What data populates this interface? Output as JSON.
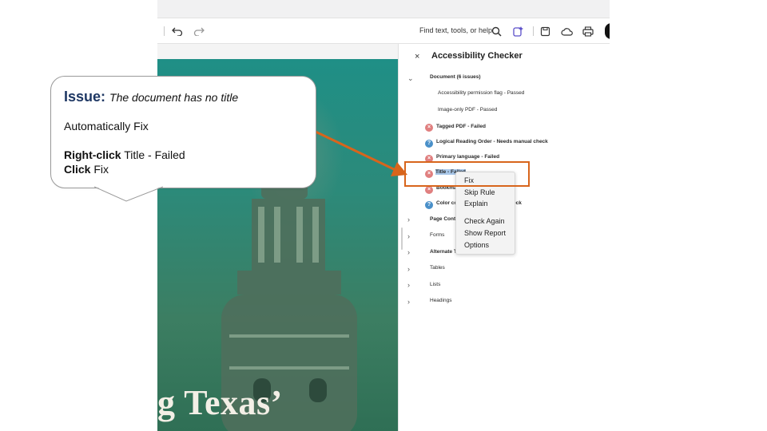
{
  "toolbar": {
    "find_text": "Find text, tools, or help",
    "accent_color": "#1f6feb"
  },
  "document": {
    "heading_fragment": "g Texas’"
  },
  "panel": {
    "close_label": "×",
    "title": "Accessibility Checker",
    "document_group": "Document (6 issues)",
    "rows": [
      {
        "label": "Accessibility permission flag - Passed",
        "status": "passed"
      },
      {
        "label": "Image-only PDF - Passed",
        "status": "passed"
      },
      {
        "label": "Tagged PDF - Failed",
        "status": "failed"
      },
      {
        "label": "Logical Reading Order - Needs manual check",
        "status": "manual"
      },
      {
        "label": "Primary language - Failed",
        "status": "failed"
      },
      {
        "label": "Title - Failed",
        "status": "failed",
        "selected": true
      },
      {
        "label": "Bookma",
        "status": "failed"
      },
      {
        "label": "Color con",
        "suffix": "eck",
        "status": "manual"
      }
    ],
    "groups": [
      {
        "label": "Page Conte",
        "bold": true
      },
      {
        "label": "Forms",
        "bold": false
      },
      {
        "label": "Alternate Te",
        "bold": true
      },
      {
        "label": "Tables",
        "bold": false
      },
      {
        "label": "Lists",
        "bold": false
      },
      {
        "label": "Headings",
        "bold": false
      }
    ]
  },
  "context_menu": {
    "items": [
      "Fix",
      "Skip Rule",
      "Explain",
      "Check Again",
      "Show Report",
      "Options"
    ]
  },
  "callout": {
    "issue_keyword": "Issue:",
    "issue_text": "The document has no title",
    "auto_fix": "Automatically Fix",
    "step1_bold": "Right-click",
    "step1_text": "Title - Failed",
    "step2_bold": "Click",
    "step2_text": "Fix",
    "accent_color": "#d8651c"
  }
}
